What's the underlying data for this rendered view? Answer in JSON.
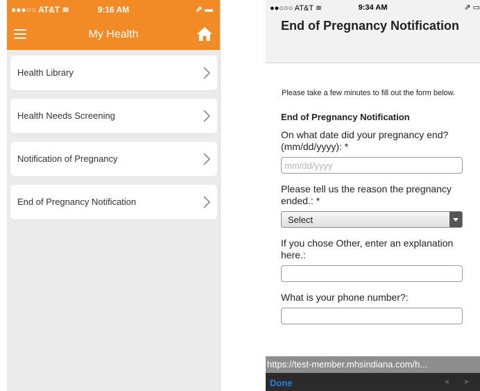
{
  "left": {
    "status": {
      "carrier": "●●●○○ AT&T ≋",
      "time": "9:16 AM",
      "right": "⇗ ▬"
    },
    "nav": {
      "title": "My Health"
    },
    "menu": [
      {
        "label": "Health Library"
      },
      {
        "label": "Health Needs Screening"
      },
      {
        "label": "Notification of Pregnancy"
      },
      {
        "label": "End of Pregnancy Notification"
      }
    ],
    "colors": {
      "accent": "#f28b26",
      "background": "#ebebeb"
    }
  },
  "right": {
    "status": {
      "carrier": "●●○○○ AT&T ≋",
      "time": "9:34 AM",
      "right": "⇗ ▭"
    },
    "header": {
      "title": "End of Pregnancy Notification"
    },
    "form": {
      "intro": "Please take a few minutes to fill out the form below.",
      "heading": "End of Pregnancy Notification",
      "q_date": "On what date did your pregnancy end? (mm/dd/yyyy): *",
      "date_placeholder": "mm/dd/yyyy",
      "q_reason": "Please tell us the reason the pregnancy ended.: *",
      "reason_value": "Select",
      "q_other": "If you chose Other, enter an explanation here.:",
      "q_phone": "What is your phone number?:"
    },
    "url": "https://test-member.mhsindiana.com/h...",
    "toolbar": {
      "done": "Done",
      "prev": "◄",
      "next": "►"
    }
  }
}
